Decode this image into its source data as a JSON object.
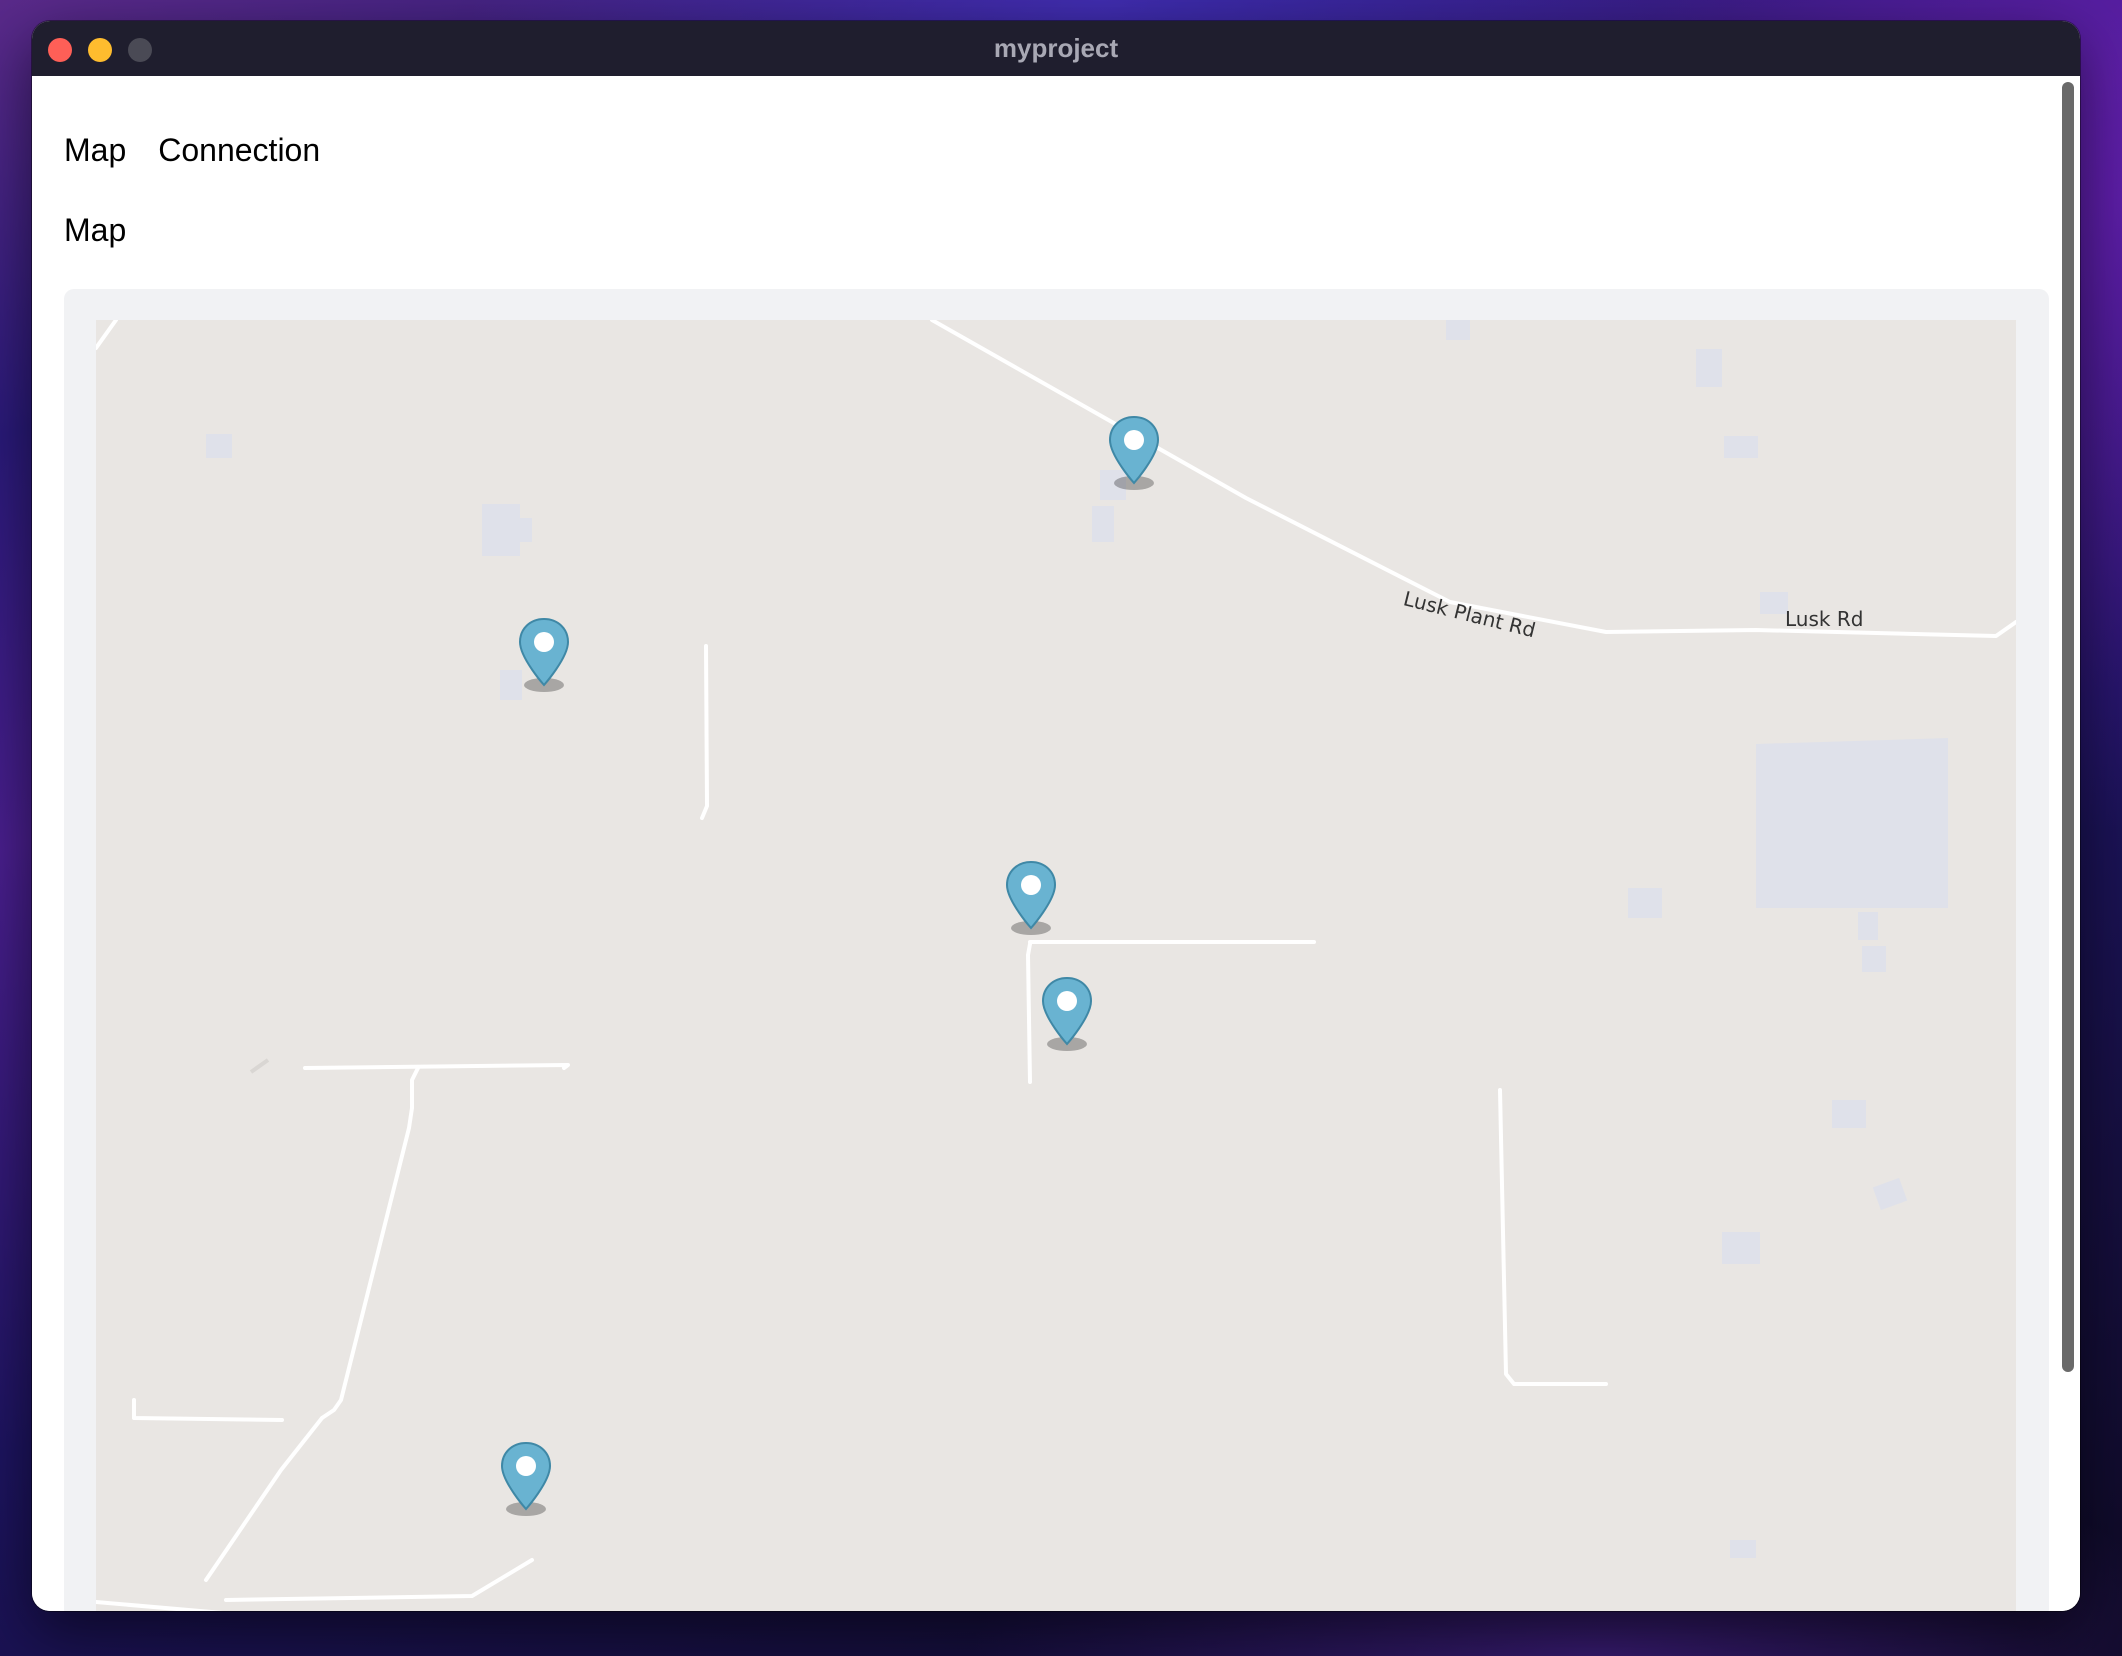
{
  "window": {
    "title": "myproject"
  },
  "nav": {
    "items": [
      {
        "label": "Map"
      },
      {
        "label": "Connection"
      }
    ]
  },
  "page": {
    "heading": "Map"
  },
  "map": {
    "road_labels": {
      "lusk_plant_rd": "Lusk Plant Rd",
      "lusk_rd": "Lusk Rd"
    },
    "marker_count": 5,
    "marker_icon": "location-pin-icon",
    "colors": {
      "land": "#e9e6e3",
      "road": "#ffffff",
      "building": "#dfe1ea",
      "marker": "#69b3d1"
    }
  }
}
